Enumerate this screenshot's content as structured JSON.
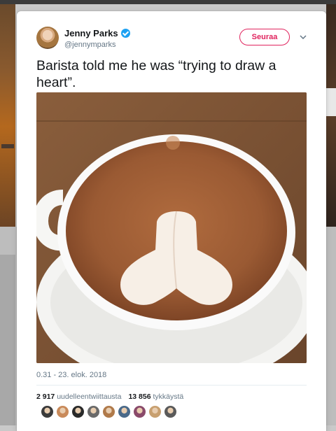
{
  "tweet": {
    "author_name": "Jenny Parks",
    "author_handle": "@jennymparks",
    "follow_label": "Seuraa",
    "text": "Barista told me he was “trying to draw a heart”.",
    "timestamp": "0.31 - 23. elok. 2018",
    "retweets_count": "2 917",
    "retweets_label": "uudelleentwiittausta",
    "likes_count": "13 856",
    "likes_label": "tykkäystä"
  },
  "icons": {
    "verified": "verified-badge-icon",
    "more": "chevron-down-icon"
  },
  "colors": {
    "accent": "#e0245e",
    "verified": "#1da1f2",
    "text": "#14171a",
    "muted": "#657786"
  },
  "likers": [
    {
      "color": "#3b3b3b"
    },
    {
      "color": "#c98a5a"
    },
    {
      "color": "#2a2a2a"
    },
    {
      "color": "#6a6a6a"
    },
    {
      "color": "#b07a4a"
    },
    {
      "color": "#4a6a8a"
    },
    {
      "color": "#8a4a6a"
    },
    {
      "color": "#c8a070"
    },
    {
      "color": "#5a5a5a"
    }
  ]
}
